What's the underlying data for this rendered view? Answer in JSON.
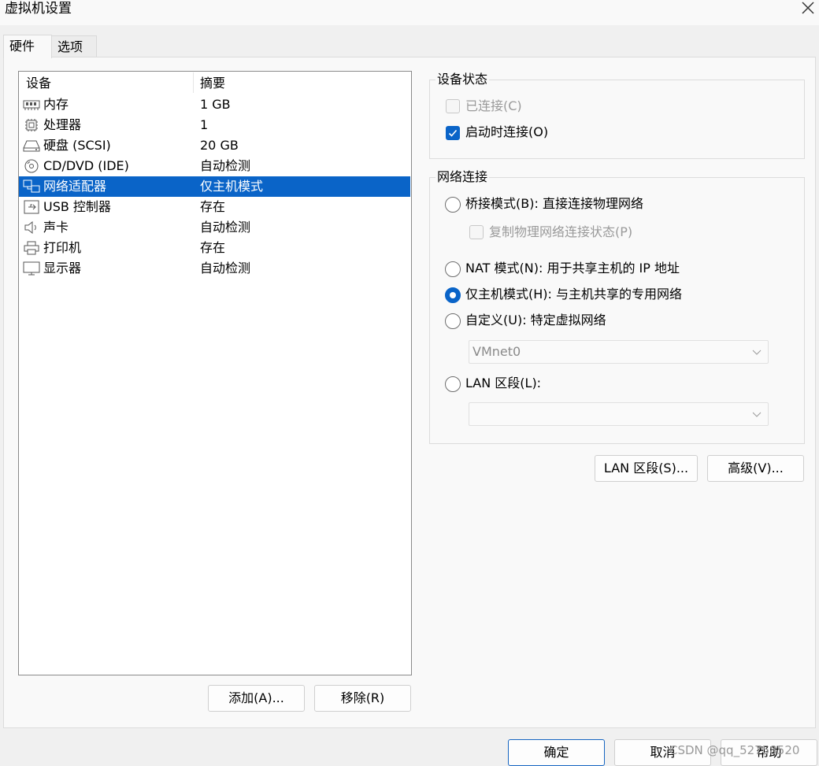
{
  "window": {
    "title": "虚拟机设置"
  },
  "tabs": [
    {
      "label": "硬件",
      "active": true
    },
    {
      "label": "选项",
      "active": false
    }
  ],
  "device_list": {
    "columns": [
      "设备",
      "摘要"
    ],
    "rows": [
      {
        "icon": "memory-icon",
        "name": "内存",
        "summary": "1 GB"
      },
      {
        "icon": "cpu-icon",
        "name": "处理器",
        "summary": "1"
      },
      {
        "icon": "harddisk-icon",
        "name": "硬盘 (SCSI)",
        "summary": "20 GB"
      },
      {
        "icon": "cd-dvd-icon",
        "name": "CD/DVD (IDE)",
        "summary": "自动检测"
      },
      {
        "icon": "network-adapter-icon",
        "name": "网络适配器",
        "summary": "仅主机模式",
        "selected": true
      },
      {
        "icon": "usb-icon",
        "name": "USB 控制器",
        "summary": "存在"
      },
      {
        "icon": "sound-card-icon",
        "name": "声卡",
        "summary": "自动检测"
      },
      {
        "icon": "printer-icon",
        "name": "打印机",
        "summary": "存在"
      },
      {
        "icon": "display-icon",
        "name": "显示器",
        "summary": "自动检测"
      }
    ],
    "add_label": "添加(A)...",
    "remove_label": "移除(R)"
  },
  "device_status": {
    "legend": "设备状态",
    "connected": {
      "label": "已连接(C)",
      "checked": false,
      "disabled": true
    },
    "connect_at_power_on": {
      "label": "启动时连接(O)",
      "checked": true
    }
  },
  "network": {
    "legend": "网络连接",
    "bridged": {
      "label": "桥接模式(B): 直接连接物理网络",
      "checked": false
    },
    "replicate": {
      "label": "复制物理网络连接状态(P)",
      "checked": false,
      "disabled": true
    },
    "nat": {
      "label": "NAT 模式(N): 用于共享主机的 IP 地址",
      "checked": false
    },
    "host_only": {
      "label": "仅主机模式(H): 与主机共享的专用网络",
      "checked": true
    },
    "custom": {
      "label": "自定义(U): 特定虚拟网络",
      "checked": false
    },
    "custom_select": "VMnet0",
    "lan_segment": {
      "label": "LAN 区段(L):",
      "checked": false
    },
    "lan_select": ""
  },
  "buttons": {
    "lan_segments": "LAN 区段(S)...",
    "advanced": "高级(V)...",
    "ok": "确定",
    "cancel": "取消",
    "help": "帮助"
  },
  "watermark": "CSDN @qq_52758520",
  "colors": {
    "accent": "#0a64c8",
    "selection": "#0a64c8"
  }
}
